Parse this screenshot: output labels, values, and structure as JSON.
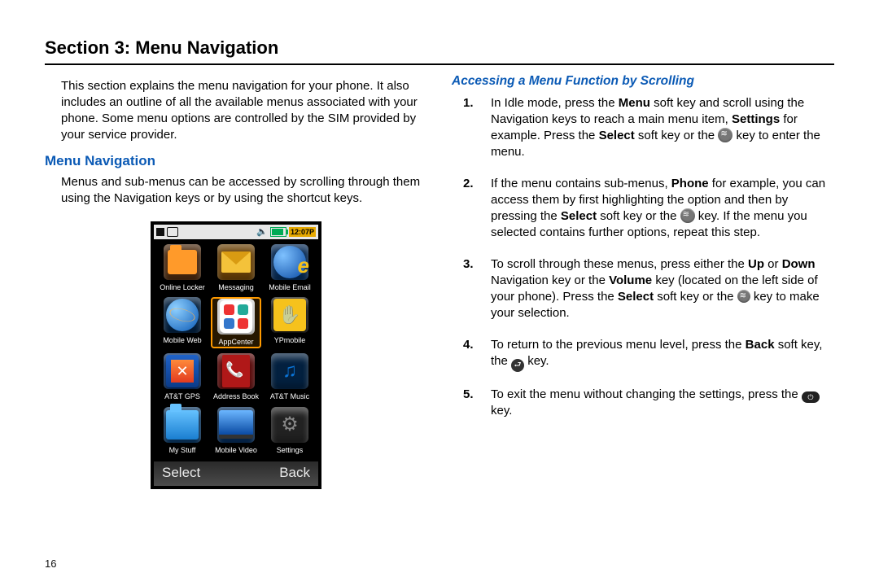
{
  "section_title": "Section 3: Menu Navigation",
  "intro": "This section explains the menu navigation for your phone. It also includes an outline of all the available menus associated with your phone. Some menu options are controlled by the SIM provided by your service provider.",
  "sub_heading": "Menu Navigation",
  "sub_para": "Menus and sub-menus can be accessed by scrolling through them using the Navigation keys or by using the shortcut keys.",
  "right_heading": "Accessing a Menu Function by Scrolling",
  "steps": {
    "s1a": "In Idle mode, press the ",
    "s1b": "Menu",
    "s1c": " soft key and scroll using the Navigation keys to reach a main menu item, ",
    "s1d": "Settings",
    "s1e": " for example. Press the ",
    "s1f": "Select",
    "s1g": " soft key or the ",
    "s1h": " key to enter the menu.",
    "s2a": "If the menu contains sub-menus, ",
    "s2b": "Phone",
    "s2c": " for example, you can access them by first highlighting the option and then by pressing the ",
    "s2d": "Select",
    "s2e": " soft key or the ",
    "s2f": " key. If the menu you selected contains further options, repeat this step.",
    "s3a": "To scroll through these menus, press either the ",
    "s3b": "Up",
    "s3c": " or ",
    "s3d": "Down",
    "s3e": " Navigation key or the ",
    "s3f": "Volume",
    "s3g": " key (located on the left side of your phone). Press the ",
    "s3h": "Select",
    "s3i": " soft key or the ",
    "s3j": " key to make your selection.",
    "s4a": "To return to the previous menu level, press the ",
    "s4b": "Back",
    "s4c": " soft key, the ",
    "s4d": " key.",
    "s5a": "To exit the menu without changing the settings, press the ",
    "s5b": " key."
  },
  "phone": {
    "clock": "12:07P",
    "soft_left": "Select",
    "soft_right": "Back",
    "apps": [
      "Online Locker",
      "Messaging",
      "Mobile Email",
      "Mobile Web",
      "AppCenter",
      "YPmobile",
      "AT&T GPS",
      "Address Book",
      "AT&T Music",
      "My Stuff",
      "Mobile Video",
      "Settings"
    ],
    "selected_index": 4
  },
  "page_number": "16"
}
